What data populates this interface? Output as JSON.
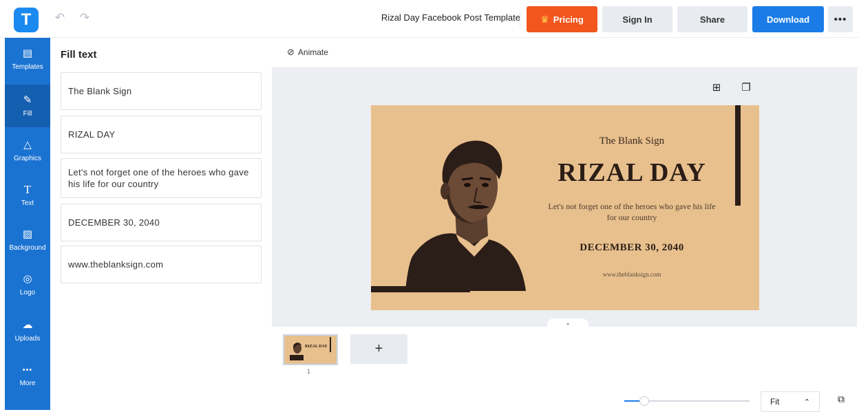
{
  "app": {
    "logo_letter": "T",
    "document_title": "Rizal Day Facebook Post Template"
  },
  "toolbar": {
    "pricing_label": "Pricing",
    "signin_label": "Sign In",
    "share_label": "Share",
    "download_label": "Download",
    "more_label": "•••",
    "undo_icon": "undo-icon",
    "redo_icon": "redo-icon"
  },
  "sidebar": {
    "items": [
      {
        "label": "Templates",
        "icon": "templates-icon",
        "glyph": "▤"
      },
      {
        "label": "Fill",
        "icon": "pencil-icon",
        "glyph": "✎"
      },
      {
        "label": "Graphics",
        "icon": "shapes-icon",
        "glyph": "△"
      },
      {
        "label": "Text",
        "icon": "text-icon",
        "glyph": "T"
      },
      {
        "label": "Background",
        "icon": "background-icon",
        "glyph": "▨"
      },
      {
        "label": "Logo",
        "icon": "logo-icon",
        "glyph": "◎"
      },
      {
        "label": "Uploads",
        "icon": "upload-icon",
        "glyph": "☁"
      },
      {
        "label": "More",
        "icon": "more-icon",
        "glyph": "•••"
      }
    ],
    "active": "Fill"
  },
  "fill_panel": {
    "title": "Fill text",
    "fields": [
      {
        "value": "The Blank Sign"
      },
      {
        "value": "RIZAL DAY"
      },
      {
        "value": "Let's not forget one of the heroes who gave his life for our country"
      },
      {
        "value": "DECEMBER 30, 2040"
      },
      {
        "value": "www.theblanksign.com"
      }
    ]
  },
  "workspace": {
    "animate_label": "Animate"
  },
  "design": {
    "background_color": "#e8c08d",
    "accent_color": "#2b1d17",
    "subtitle": "The Blank Sign",
    "title": "RIZAL DAY",
    "description": "Let's not forget one of the heroes who gave his life for our country",
    "date": "DECEMBER 30, 2040",
    "url": "www.theblanksign.com"
  },
  "pages": {
    "thumb_title": "RIZAL DAY",
    "current_page_number": "1",
    "add_page_label": "+"
  },
  "zoom": {
    "value_label": "Fit",
    "slider_fraction": 0.16
  },
  "colors": {
    "brand": "#1b8af0",
    "pricing": "#f2561d",
    "download": "#1b7ce8",
    "rail": "#1b73d1"
  }
}
